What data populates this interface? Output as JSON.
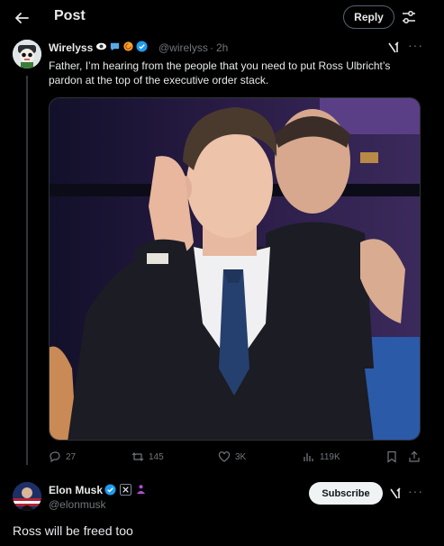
{
  "header": {
    "title": "Post",
    "reply_label": "Reply"
  },
  "tweet": {
    "display_name": "Wirelyss",
    "handle": "@wirelyss",
    "separator": "·",
    "time": "2h",
    "text": "Father, I’m hearing from the people that you need to put Ross Ulbricht’s pardon at the top of the executive order stack.",
    "stats": {
      "replies": "27",
      "reposts": "145",
      "likes": "3K",
      "views": "119K"
    }
  },
  "reply": {
    "display_name": "Elon Musk",
    "handle": "@elonmusk",
    "subscribe_label": "Subscribe",
    "text": "Ross will be freed too"
  },
  "colors": {
    "background": "#000000",
    "text": "#e7e9ea",
    "muted": "#71767b",
    "verified": "#1d9bf0",
    "border": "#2f3336"
  },
  "icons": [
    "back-arrow-icon",
    "sliders-icon",
    "verified-icon",
    "grok-icon",
    "more-icon",
    "reply-icon",
    "repost-icon",
    "like-icon",
    "views-icon",
    "bookmark-icon",
    "share-icon"
  ]
}
